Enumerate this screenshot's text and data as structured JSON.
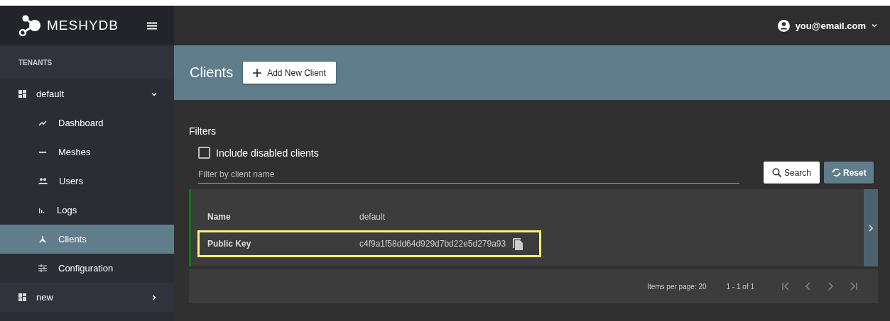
{
  "brand": {
    "name": "MESHYDB"
  },
  "user": {
    "email": "you@email.com"
  },
  "sidebar": {
    "section": "TENANTS",
    "tenants": [
      {
        "label": "default",
        "expanded": true,
        "children": [
          {
            "label": "Dashboard",
            "selected": false
          },
          {
            "label": "Meshes",
            "selected": false
          },
          {
            "label": "Users",
            "selected": false
          },
          {
            "label": "Logs",
            "selected": false
          },
          {
            "label": "Clients",
            "selected": true
          },
          {
            "label": "Configuration",
            "selected": false
          }
        ]
      },
      {
        "label": "new",
        "expanded": false
      }
    ]
  },
  "page": {
    "title": "Clients",
    "add_button": "Add New Client"
  },
  "filters": {
    "title": "Filters",
    "include_disabled": {
      "label": "Include disabled clients",
      "checked": false
    },
    "search": {
      "placeholder": "Filter by client name"
    },
    "search_button": "Search",
    "reset_button": "Reset"
  },
  "clients": [
    {
      "rows": [
        {
          "label": "Name",
          "value": "default",
          "highlighted": false,
          "copy": false
        },
        {
          "label": "Public Key",
          "value": "c4f9a1f58dd64d929d7bd22e5d279a93",
          "highlighted": true,
          "copy": true
        }
      ]
    }
  ],
  "pager": {
    "items_per_page": "Items per page: 20",
    "range": "1 - 1 of 1"
  }
}
